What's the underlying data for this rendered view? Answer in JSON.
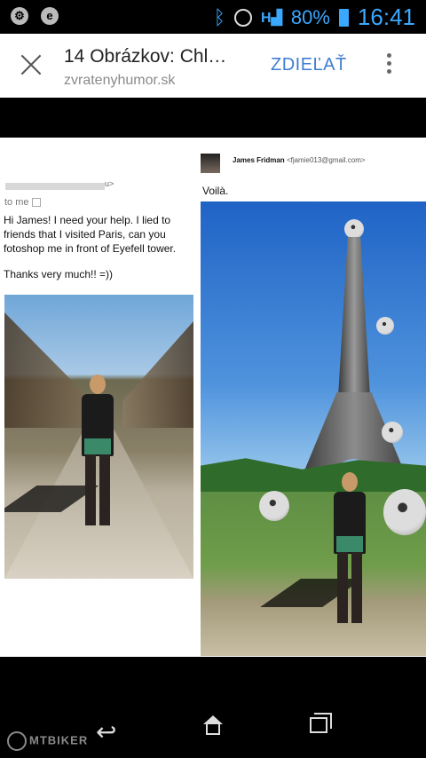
{
  "status_bar": {
    "battery": "80%",
    "time": "16:41",
    "signal_label": "H",
    "left_icons": [
      "settings-icon",
      "e-icon"
    ],
    "accent": "#3ba8ff"
  },
  "app_bar": {
    "title": "14 Obrázkov: Chl…",
    "url": "zvratenyhumor.sk",
    "share_label": "ZDIEĽAŤ"
  },
  "left_email": {
    "from_suffix": "u>",
    "to_me": "to me",
    "message": "Hi James! I need your help. I lied to friends that I visited Paris, can you fotoshop me in front of Eyefell tower.",
    "thanks": "Thanks very much!! =))"
  },
  "right_email": {
    "sender_name": "James Fridman",
    "sender_email": "<fjamie013@gmail.com>",
    "reply": "Voilà."
  },
  "watermark": "MTBIKER"
}
